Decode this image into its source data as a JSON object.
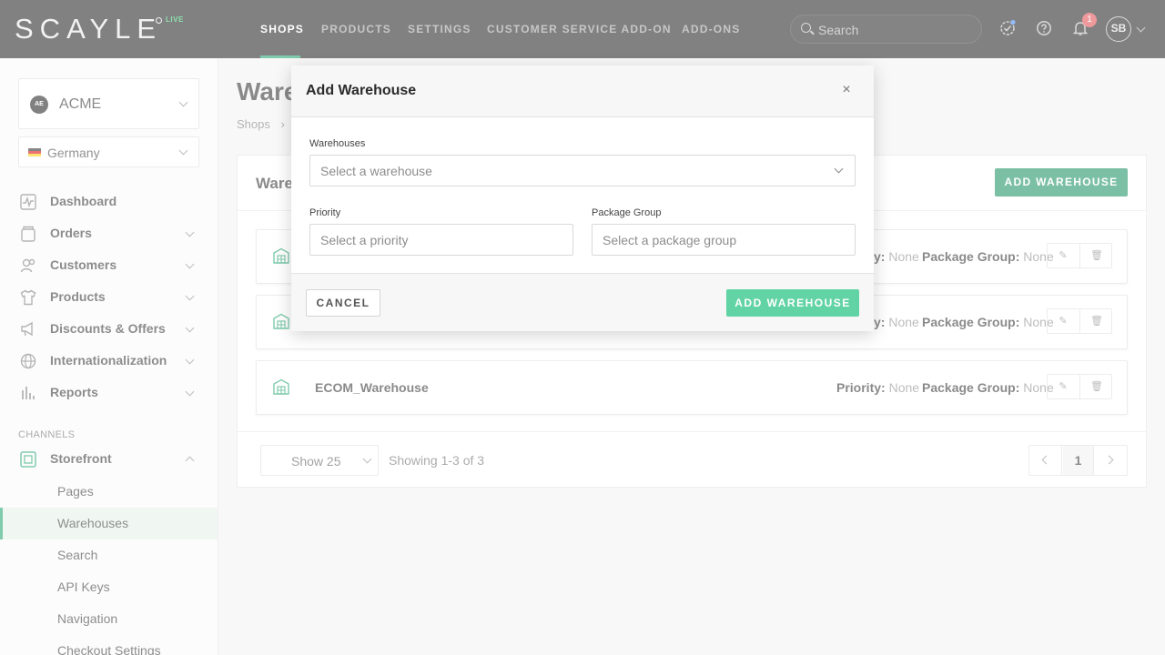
{
  "topbar": {
    "logo": "SCAYLE",
    "live_label": "LIVE",
    "nav": [
      {
        "label": "SHOPS",
        "active": true
      },
      {
        "label": "PRODUCTS"
      },
      {
        "label": "SETTINGS"
      },
      {
        "label": "CUSTOMER SERVICE ADD-ON"
      },
      {
        "label": "ADD-ONS"
      }
    ],
    "search_placeholder": "Search",
    "notifications_count": "1",
    "avatar_initials": "SB"
  },
  "sidebar": {
    "shop": {
      "logo": "AE",
      "name": "ACME"
    },
    "country": "Germany",
    "menu": [
      {
        "label": "Dashboard",
        "icon": "dashboard-icon"
      },
      {
        "label": "Orders",
        "icon": "orders-icon"
      },
      {
        "label": "Customers",
        "icon": "customers-icon"
      },
      {
        "label": "Products",
        "icon": "shirt-icon"
      },
      {
        "label": "Discounts & Offers",
        "icon": "megaphone-icon"
      },
      {
        "label": "Internationalization",
        "icon": "globe-icon"
      },
      {
        "label": "Reports",
        "icon": "bar-chart-icon"
      }
    ],
    "channels_label": "CHANNELS",
    "storefront": {
      "label": "Storefront",
      "icon": "storefront-icon"
    },
    "sub_items": [
      {
        "label": "Pages"
      },
      {
        "label": "Warehouses",
        "active": true
      },
      {
        "label": "Search"
      },
      {
        "label": "API Keys"
      },
      {
        "label": "Navigation"
      },
      {
        "label": "Checkout Settings"
      }
    ]
  },
  "main": {
    "title": "Ware",
    "breadcrumb": "Shops",
    "card_title": "Ware",
    "add_button": "ADD WAREHOUSE",
    "rows": [
      {
        "name": "",
        "priority_label": "y:",
        "priority": "None",
        "package_group_label": "Package Group:",
        "package_group": "None"
      },
      {
        "name": "",
        "priority_label": "y:",
        "priority": "None",
        "package_group_label": "Package Group:",
        "package_group": "None"
      },
      {
        "name": "ECOM_Warehouse",
        "priority_label": "Priority:",
        "priority": "None",
        "package_group_label": "Package Group:",
        "package_group": "None"
      }
    ],
    "page_size": "Show 25",
    "showing": "Showing 1-3 of 3",
    "current_page": "1"
  },
  "modal": {
    "title": "Add Warehouse",
    "close": "×",
    "warehouses_label": "Warehouses",
    "warehouses_placeholder": "Select a warehouse",
    "priority_label": "Priority",
    "priority_placeholder": "Select a priority",
    "package_group_label": "Package Group",
    "package_group_placeholder": "Select a package group",
    "cancel": "CANCEL",
    "confirm": "ADD WAREHOUSE"
  },
  "colors": {
    "brand_green": "#0f8a5a",
    "confirm_disabled": "#62d3a4",
    "topbar": "#1a1a1a",
    "notification": "#e0464b"
  }
}
